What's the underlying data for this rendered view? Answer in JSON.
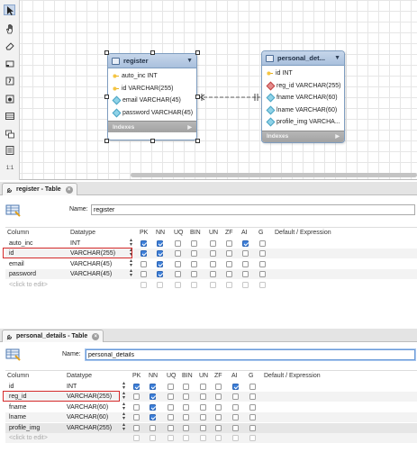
{
  "canvas": {
    "zoom": "1:1",
    "tools": [
      "arrow-tool",
      "hand-tool",
      "eraser-tool",
      "layer-tool",
      "text-tool",
      "image-tool",
      "table-tool",
      "view-tool",
      "routine-tool"
    ],
    "register_entity": {
      "title": "register",
      "columns": [
        {
          "icon": "key",
          "text": "auto_inc INT"
        },
        {
          "icon": "key",
          "text": "id VARCHAR(255)"
        },
        {
          "icon": "diamond",
          "text": "email VARCHAR(45)"
        },
        {
          "icon": "diamond",
          "text": "password VARCHAR(45)"
        }
      ],
      "indexes_label": "Indexes"
    },
    "personal_entity": {
      "title": "personal_det...",
      "columns": [
        {
          "icon": "key",
          "text": "id INT"
        },
        {
          "icon": "diamond-red",
          "text": "reg_id VARCHAR(255)"
        },
        {
          "icon": "diamond",
          "text": "fname VARCHAR(60)"
        },
        {
          "icon": "diamond",
          "text": "lname VARCHAR(60)"
        },
        {
          "icon": "diamond",
          "text": "profile_img VARCHA..."
        }
      ],
      "indexes_label": "Indexes"
    }
  },
  "register_editor": {
    "tab_label": "register - Table",
    "name_label": "Name:",
    "name_value": "register",
    "headers": [
      "Column",
      "Datatype",
      "PK",
      "NN",
      "UQ",
      "BIN",
      "UN",
      "ZF",
      "AI",
      "G",
      "Default / Expression"
    ],
    "rows": [
      {
        "column": "auto_inc",
        "datatype": "INT",
        "flags": [
          true,
          true,
          false,
          false,
          false,
          false,
          true,
          false
        ]
      },
      {
        "column": "id",
        "datatype": "VARCHAR(255)",
        "flags": [
          true,
          true,
          false,
          false,
          false,
          false,
          false,
          false
        ]
      },
      {
        "column": "email",
        "datatype": "VARCHAR(45)",
        "flags": [
          false,
          true,
          false,
          false,
          false,
          false,
          false,
          false
        ]
      },
      {
        "column": "password",
        "datatype": "VARCHAR(45)",
        "flags": [
          false,
          true,
          false,
          false,
          false,
          false,
          false,
          false
        ]
      }
    ],
    "placeholder": "<click to edit>"
  },
  "personal_editor": {
    "tab_label": "personal_details - Table",
    "name_label": "Name:",
    "name_value": "personal_details",
    "headers": [
      "Column",
      "Datatype",
      "PK",
      "NN",
      "UQ",
      "BIN",
      "UN",
      "ZF",
      "AI",
      "G",
      "Default / Expression"
    ],
    "rows": [
      {
        "column": "id",
        "datatype": "INT",
        "flags": [
          true,
          true,
          false,
          false,
          false,
          false,
          true,
          false
        ]
      },
      {
        "column": "reg_id",
        "datatype": "VARCHAR(255)",
        "flags": [
          false,
          true,
          false,
          false,
          false,
          false,
          false,
          false
        ]
      },
      {
        "column": "fname",
        "datatype": "VARCHAR(60)",
        "flags": [
          false,
          true,
          false,
          false,
          false,
          false,
          false,
          false
        ]
      },
      {
        "column": "lname",
        "datatype": "VARCHAR(60)",
        "flags": [
          false,
          true,
          false,
          false,
          false,
          false,
          false,
          false
        ]
      },
      {
        "column": "profile_img",
        "datatype": "VARCHAR(255)",
        "flags": [
          false,
          false,
          false,
          false,
          false,
          false,
          false,
          false
        ]
      }
    ],
    "placeholder": "<click to edit>"
  },
  "colors": {
    "checkbox_on": "#3d7fd9",
    "highlight": "#d42a2a",
    "entity_header": "#a9c0dd"
  }
}
